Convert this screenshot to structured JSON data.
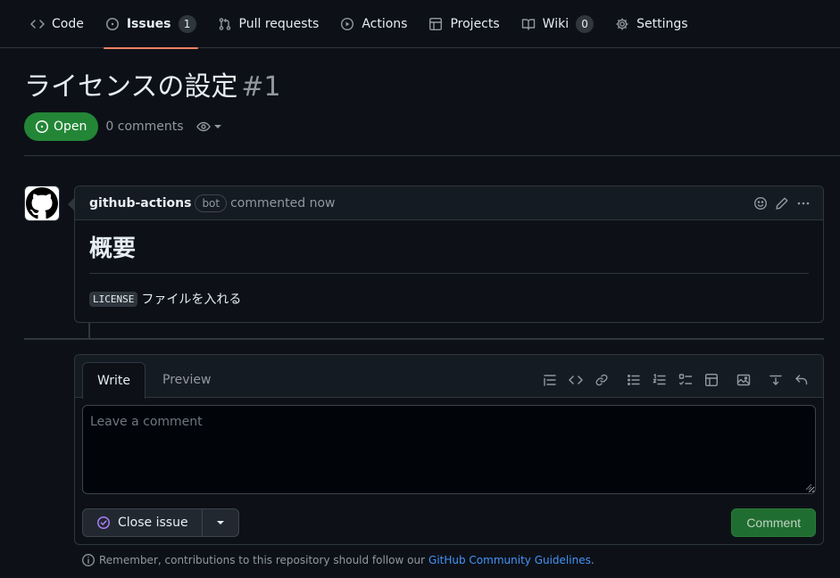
{
  "nav": {
    "tabs": [
      {
        "label": "Code",
        "icon": "code-icon"
      },
      {
        "label": "Issues",
        "icon": "issue-opened-icon",
        "count": "1",
        "active": true
      },
      {
        "label": "Pull requests",
        "icon": "git-pull-request-icon"
      },
      {
        "label": "Actions",
        "icon": "play-icon"
      },
      {
        "label": "Projects",
        "icon": "table-icon"
      },
      {
        "label": "Wiki",
        "icon": "book-icon",
        "count": "0"
      },
      {
        "label": "Settings",
        "icon": "gear-icon"
      }
    ]
  },
  "issue": {
    "title": "ライセンスの設定",
    "number": "#1",
    "state": "Open",
    "comment_count": "0 comments"
  },
  "comment": {
    "author": "github-actions",
    "badge": "bot",
    "time": "commented now",
    "heading": "概要",
    "code": "LICENSE",
    "text": "ファイルを入れる"
  },
  "form": {
    "tab_write": "Write",
    "tab_preview": "Preview",
    "placeholder": "Leave a comment",
    "close_label": "Close issue",
    "submit_label": "Comment"
  },
  "footer": {
    "text": "Remember, contributions to this repository should follow our",
    "link": "GitHub Community Guidelines",
    "suffix": "."
  },
  "colors": {
    "background": "#0d1117",
    "border": "#30363d",
    "open_green": "#238636",
    "active_tab_underline": "#f78166",
    "link": "#4493f8",
    "closed_purple": "#ab7df8"
  }
}
